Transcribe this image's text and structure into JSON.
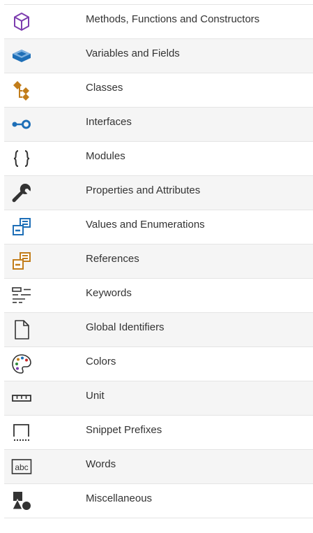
{
  "rows": [
    {
      "label": "Methods, Functions and Constructors",
      "icon": "method-cube-icon",
      "color": "#7d3daf"
    },
    {
      "label": "Variables and Fields",
      "icon": "variable-box-icon",
      "color": "#1e6fb7"
    },
    {
      "label": "Classes",
      "icon": "class-icon",
      "color": "#c27d1a"
    },
    {
      "label": "Interfaces",
      "icon": "interface-icon",
      "color": "#1e6fb7"
    },
    {
      "label": "Modules",
      "icon": "braces-icon",
      "color": "#333333"
    },
    {
      "label": "Properties and Attributes",
      "icon": "wrench-icon",
      "color": "#333333"
    },
    {
      "label": "Values and Enumerations",
      "icon": "enum-icon",
      "color": "#1e6fb7"
    },
    {
      "label": "References",
      "icon": "reference-icon",
      "color": "#c27d1a"
    },
    {
      "label": "Keywords",
      "icon": "keyword-icon",
      "color": "#333333"
    },
    {
      "label": "Global Identifiers",
      "icon": "file-icon",
      "color": "#333333"
    },
    {
      "label": "Colors",
      "icon": "palette-icon",
      "color": "#333333"
    },
    {
      "label": "Unit",
      "icon": "ruler-icon",
      "color": "#333333"
    },
    {
      "label": "Snippet Prefixes",
      "icon": "snippet-icon",
      "color": "#333333"
    },
    {
      "label": "Words",
      "icon": "text-abc-icon",
      "color": "#333333"
    },
    {
      "label": "Miscellaneous",
      "icon": "shapes-icon",
      "color": "#333333"
    }
  ],
  "icon_text": {
    "abc": "abc"
  }
}
